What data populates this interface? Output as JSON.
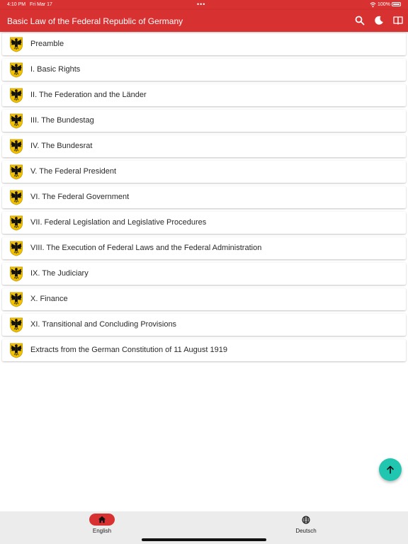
{
  "status_bar": {
    "time": "4:10 PM",
    "date": "Fri Mar 17",
    "battery": "100%",
    "dots": "•••"
  },
  "app_bar": {
    "title": "Basic Law of the Federal Republic of Germany"
  },
  "toc": {
    "items": [
      {
        "label": "Preamble"
      },
      {
        "label": "I. Basic Rights"
      },
      {
        "label": "II. The Federation and the Länder"
      },
      {
        "label": "III. The Bundestag"
      },
      {
        "label": "IV. The Bundesrat"
      },
      {
        "label": "V. The Federal President"
      },
      {
        "label": "VI. The Federal Government"
      },
      {
        "label": "VII. Federal Legislation and Legislative Procedures"
      },
      {
        "label": "VIII. The Execution of Federal Laws and the Federal Administration"
      },
      {
        "label": "IX. The Judiciary"
      },
      {
        "label": "X. Finance"
      },
      {
        "label": "XI. Transitional and Concluding Provisions"
      },
      {
        "label": "Extracts from the German Constitution of 11 August 1919"
      }
    ],
    "item_icon": "federal-eagle-icon"
  },
  "bottom_nav": {
    "english": {
      "label": "English",
      "icon": "home-icon",
      "selected": true
    },
    "deutsch": {
      "label": "Deutsch",
      "icon": "globe-icon",
      "selected": false
    }
  },
  "colors": {
    "primary": "#d83131",
    "fab": "#21c6b0",
    "nav_bg": "#ececec"
  }
}
